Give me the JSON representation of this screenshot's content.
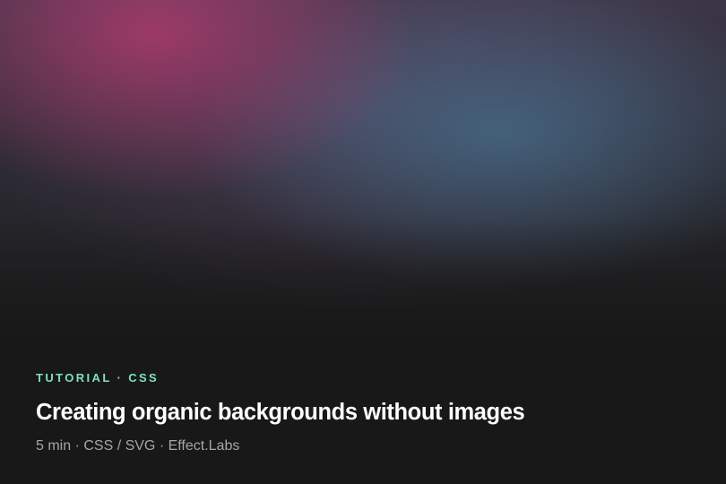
{
  "card": {
    "eyebrow": "TUTORIAL · CSS",
    "title": "Creating organic backgrounds without images",
    "meta": "5 min · CSS / SVG · Effect.Labs"
  },
  "colors": {
    "eyebrow": "#7ee2bd",
    "title": "#ffffff",
    "meta": "#a6a6a6",
    "base": "#1c1c1c",
    "magenta": "#b03a6e",
    "teal": "#48789a"
  }
}
